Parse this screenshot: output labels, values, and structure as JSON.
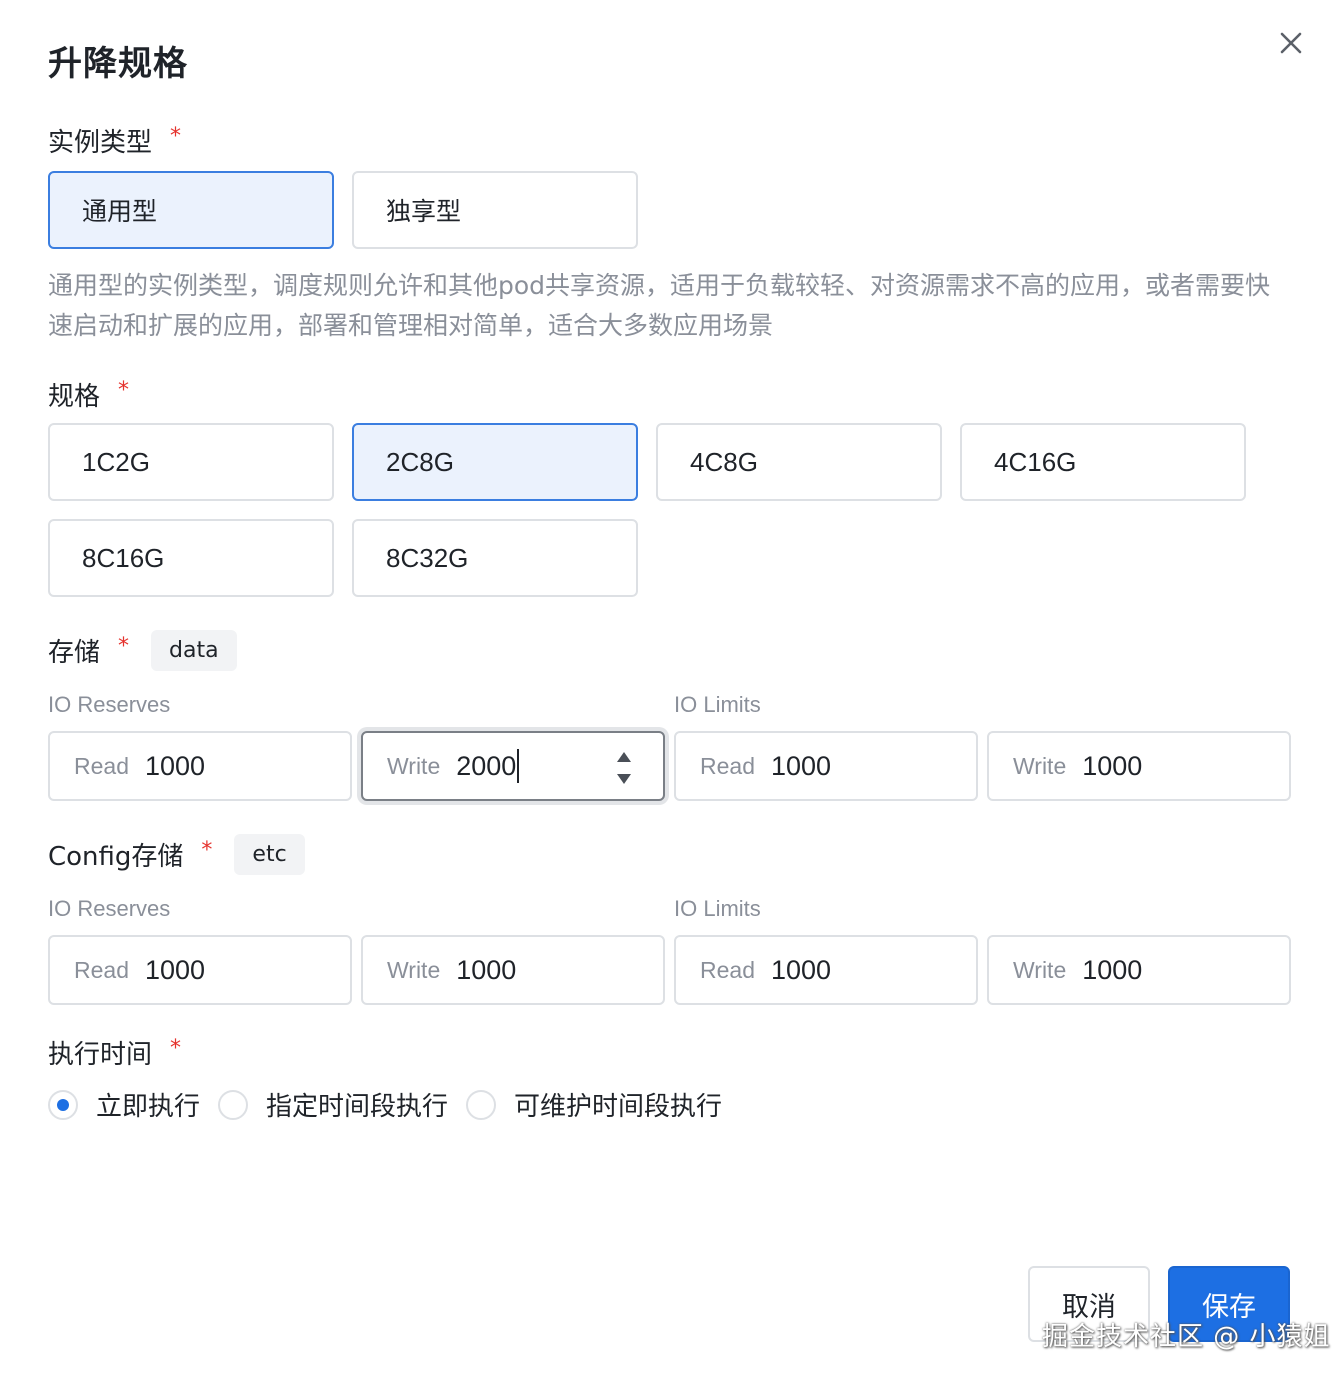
{
  "dialog": {
    "title": "升降规格",
    "close_icon": "close-icon"
  },
  "instance_type": {
    "label": "实例类型",
    "required": "*",
    "options": [
      "通用型",
      "独享型"
    ],
    "selected": "通用型",
    "description": "通用型的实例类型，调度规则允许和其他pod共享资源，适用于负载较轻、对资源需求不高的应用，或者需要快速启动和扩展的应用，部署和管理相对简单，适合大多数应用场景"
  },
  "spec": {
    "label": "规格",
    "required": "*",
    "options": [
      "1C2G",
      "2C8G",
      "4C8G",
      "4C16G",
      "8C16G",
      "8C32G"
    ],
    "selected": "2C8G"
  },
  "storage": {
    "label": "存储",
    "required": "*",
    "tag": "data",
    "reserves_label": "IO Reserves",
    "limits_label": "IO Limits",
    "fields": [
      {
        "prefix": "Read",
        "value": "1000"
      },
      {
        "prefix": "Write",
        "value": "2000"
      },
      {
        "prefix": "Read",
        "value": "1000"
      },
      {
        "prefix": "Write",
        "value": "1000"
      }
    ]
  },
  "config_storage": {
    "label": "Config存储",
    "required": "*",
    "tag": "etc",
    "reserves_label": "IO Reserves",
    "limits_label": "IO Limits",
    "fields": [
      {
        "prefix": "Read",
        "value": "1000"
      },
      {
        "prefix": "Write",
        "value": "1000"
      },
      {
        "prefix": "Read",
        "value": "1000"
      },
      {
        "prefix": "Write",
        "value": "1000"
      }
    ]
  },
  "exec_time": {
    "label": "执行时间",
    "required": "*",
    "options": [
      "立即执行",
      "指定时间段执行",
      "可维护时间段执行"
    ],
    "selected": "立即执行"
  },
  "footer": {
    "cancel": "取消",
    "save": "保存"
  },
  "watermark": "掘金技术社区 @ 小猿姐",
  "colors": {
    "primary": "#1d6fe3",
    "selected_bg": "#ebf2fd",
    "required": "#e5332e"
  }
}
